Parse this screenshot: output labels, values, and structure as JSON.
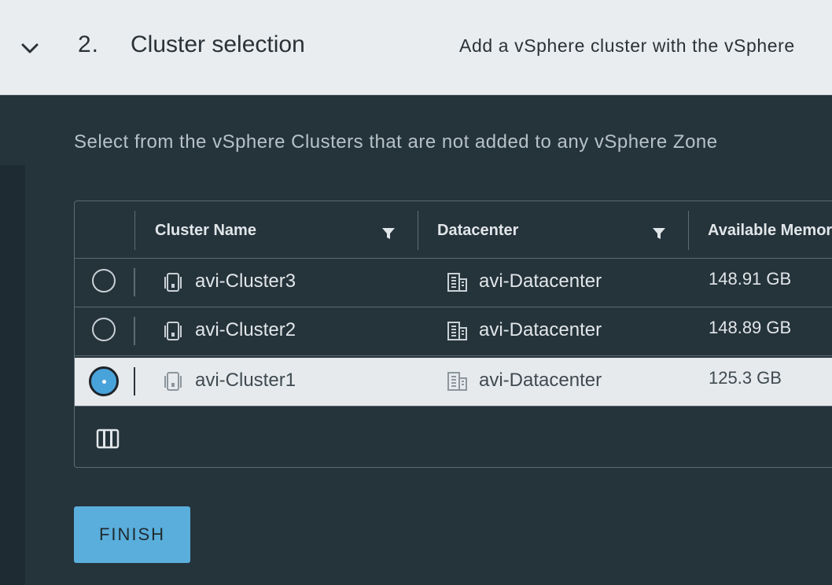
{
  "step": {
    "number": "2.",
    "title": "Cluster selection",
    "description": "Add a vSphere cluster with the vSphere"
  },
  "instruction": "Select from the vSphere Clusters that are not added to any vSphere Zone",
  "grid": {
    "columns": [
      "Cluster Name",
      "Datacenter",
      "Available Memory"
    ],
    "rows": [
      {
        "cluster": "avi-Cluster3",
        "datacenter": "avi-Datacenter",
        "memory": "148.91 GB",
        "selected": false
      },
      {
        "cluster": "avi-Cluster2",
        "datacenter": "avi-Datacenter",
        "memory": "148.89 GB",
        "selected": false
      },
      {
        "cluster": "avi-Cluster1",
        "datacenter": "avi-Datacenter",
        "memory": "125.3 GB",
        "selected": true
      }
    ]
  },
  "finish_label": "FINISH",
  "colors": {
    "accent": "#5aaedb",
    "radio_selected": "#49a3db",
    "header_bg": "#e9edf0",
    "panel_bg": "#25333b"
  },
  "icons": {
    "expand": "chevron-down-icon",
    "filter": "filter-icon",
    "cluster": "cluster-icon",
    "datacenter": "datacenter-icon",
    "columns": "column-toggle-icon"
  }
}
